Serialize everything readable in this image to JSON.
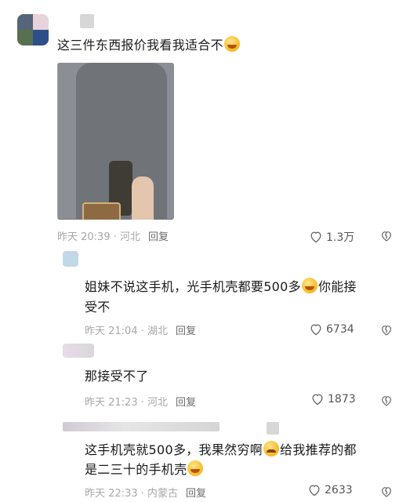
{
  "comments": [
    {
      "text": "这三件东西报价我看我适合不",
      "time": "昨天 20:39 · 河北",
      "reply": "回复",
      "likes": "1.3万"
    },
    {
      "text_1": "姐妹不说这手机，光手机壳都要500多",
      "text_2": "你能接",
      "text_3": "受不",
      "time": "昨天 21:04 · 湖北",
      "reply": "回复",
      "likes": "6734"
    },
    {
      "text": "那接受不了",
      "time": "昨天 21:23 · 河北",
      "reply": "回复",
      "likes": "1873"
    },
    {
      "text_1": "这手机壳就500多，我果然穷啊",
      "text_2": "给我推荐的都",
      "text_3": "是二三十的手机壳",
      "time": "昨天 22:33 · 内蒙古",
      "reply": "回复",
      "likes": "2633"
    }
  ],
  "icons": {
    "like": "heart-outline-icon",
    "dislike": "broken-heart-icon",
    "laugh": "laughing-tears-emoji",
    "sad": "worried-emoji"
  },
  "colors": {
    "meta": "#a8a8a8",
    "reply": "#6b6b6b",
    "text": "#1a1a1a"
  }
}
